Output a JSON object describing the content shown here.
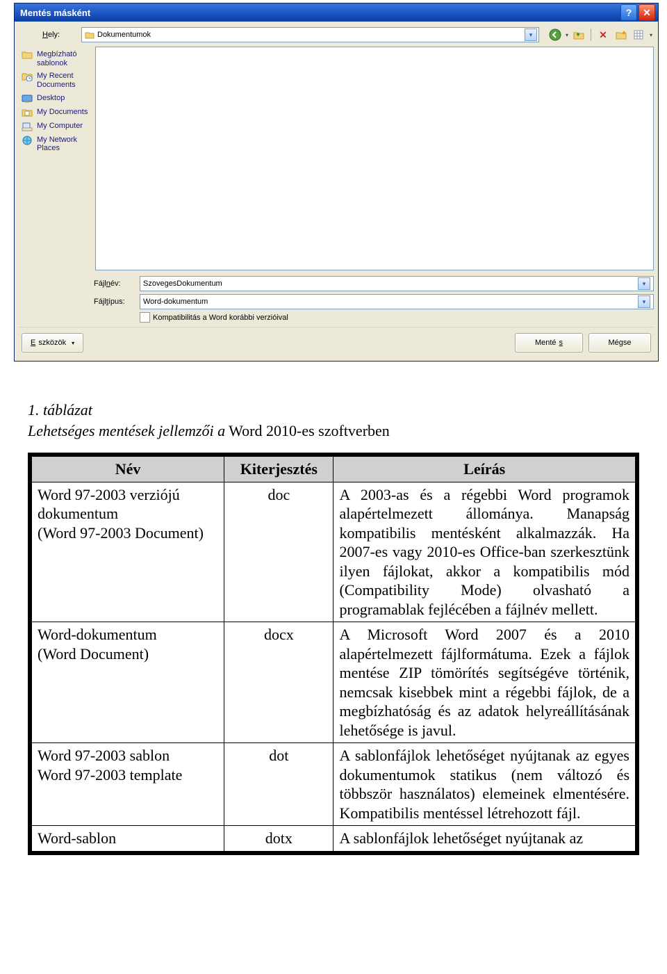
{
  "dialog": {
    "title": "Mentés másként",
    "hely_label": "Hely:",
    "hely_value": "Dokumentumok",
    "places": [
      "Megbízható sablonok",
      "My Recent Documents",
      "Desktop",
      "My Documents",
      "My Computer",
      "My Network Places"
    ],
    "filename_label": "Fájlnév:",
    "filename_value": "SzovegesDokumentum",
    "filetype_label": "Fájltípus:",
    "filetype_value": "Word-dokumentum",
    "compat_label": "Kompatibilitás a Word korábbi verzióival",
    "tools_label": "Eszközök",
    "save_label": "Mentés",
    "cancel_label": "Mégse"
  },
  "doc": {
    "caption": "1. táblázat",
    "subcaption_italic": "Lehetséges mentések jellemzői a",
    "subcaption_rest": " Word 2010-es szoftverben",
    "headers": [
      "Név",
      "Kiterjesztés",
      "Leírás"
    ],
    "rows": [
      {
        "name": "Word 97-2003 verziójú dokumentum\n(Word 97-2003 Document)",
        "ext": "doc",
        "desc": "A 2003-as és a régebbi Word programok alapértelmezett állománya. Manapság kompatibilis mentésként alkalmazzák. Ha 2007-es vagy 2010-es Office-ban szerkesztünk ilyen fájlokat, akkor a kompatibilis mód (Compatibility Mode) olvasható a programablak fejlécében a fájlnév mellett."
      },
      {
        "name": "Word-dokumentum\n(Word Document)",
        "ext": "docx",
        "desc": "A Microsoft Word 2007 és a 2010 alapértelmezett fájlformátuma. Ezek a fájlok mentése ZIP tömörítés segítségéve történik, nemcsak kisebbek mint a régebbi fájlok, de a megbízhatóság és az adatok helyreállításának lehetősége is javul."
      },
      {
        "name": "Word 97-2003 sablon\nWord 97-2003 template",
        "ext": "dot",
        "desc": "A sablonfájlok lehetőséget nyújtanak az egyes dokumentumok statikus (nem változó és többször használatos) elemeinek elmentésére. Kompatibilis mentéssel létrehozott fájl."
      },
      {
        "name": "Word-sablon",
        "ext": "dotx",
        "desc": "A sablonfájlok lehetőséget nyújtanak az"
      }
    ]
  }
}
